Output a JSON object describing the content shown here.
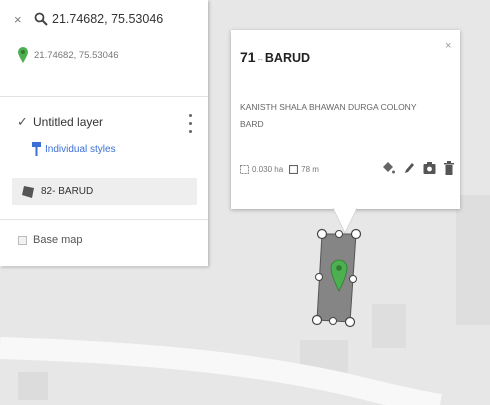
{
  "search": {
    "query": "21.74682, 75.53046"
  },
  "result": {
    "coords": "21.74682, 75.53046"
  },
  "layer": {
    "name": "Untitled layer",
    "styles_link": "Individual styles"
  },
  "feature": {
    "label": "82- BARUD"
  },
  "basemap": {
    "label": "Base map"
  },
  "popup": {
    "title_number": "71",
    "title_separator": "--",
    "title_name": "BARUD",
    "description_line1": "KANISTH SHALA BHAWAN DURGA COLONY",
    "description_line2": "BARD",
    "area": "0.030 ha",
    "perimeter": "78 m",
    "close_glyph": "×"
  },
  "colors": {
    "link": "#3a6fd6",
    "pin": "#4caf50",
    "polygon": "#858585"
  }
}
